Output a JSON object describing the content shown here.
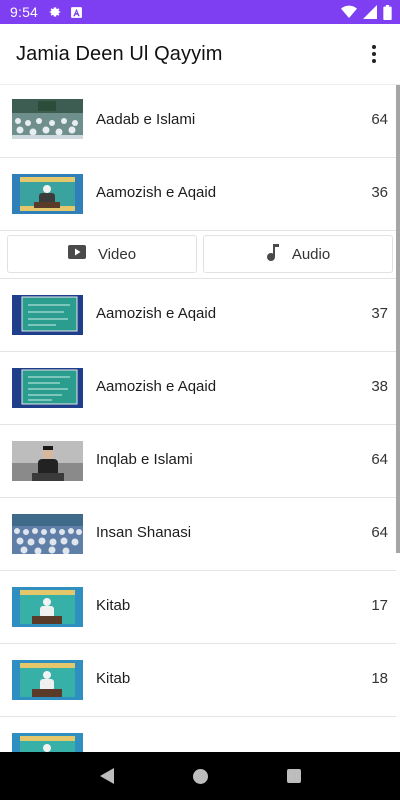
{
  "status_bar": {
    "time": "9:54",
    "background": "#7e3ff2"
  },
  "app_bar": {
    "title": "Jamia Deen Ul Qayyim"
  },
  "media_buttons": {
    "video_label": "Video",
    "audio_label": "Audio"
  },
  "rows": [
    {
      "title": "Aadab e Islami",
      "count": "64",
      "thumb": "crowd-hall"
    },
    {
      "title": "Aamozish e Aqaid",
      "count": "36",
      "thumb": "speaker-frame"
    },
    {
      "title": "Aamozish e Aqaid",
      "count": "37",
      "thumb": "board"
    },
    {
      "title": "Aamozish e Aqaid",
      "count": "38",
      "thumb": "board"
    },
    {
      "title": "Inqlab e Islami",
      "count": "64",
      "thumb": "speaker-dark"
    },
    {
      "title": "Insan Shanasi",
      "count": "64",
      "thumb": "crowd-hall"
    },
    {
      "title": "Kitab",
      "count": "17",
      "thumb": "speaker-frame"
    },
    {
      "title": "Kitab",
      "count": "18",
      "thumb": "speaker-frame"
    }
  ]
}
